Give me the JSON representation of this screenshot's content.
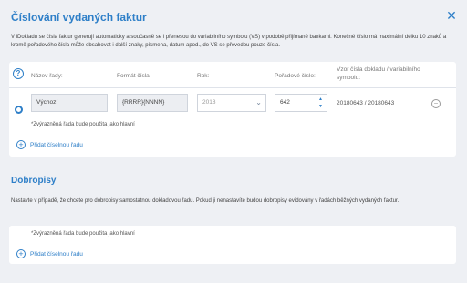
{
  "dialog": {
    "title": "Číslování vydaných faktur",
    "description": "V iDokladu se čísla faktur generují automaticky a současně se i přenesou do variabilního symbolu (VS) v podobě přijímané bankami. Konečné číslo má maximální délku 10 znaků a kromě pořadového čísla může obsahovat i další znaky, písmena, datum apod., do VS se převedou pouze čísla."
  },
  "table": {
    "headers": {
      "name": "Název řady:",
      "format": "Formát čísla:",
      "year": "Rok:",
      "order": "Pořadové číslo:",
      "sample_line1": "Vzor čísla dokladu / variabilního",
      "sample_line2": "symbolu:"
    },
    "row": {
      "name": "Výchozí",
      "format": "{RRRR}{NNNN}",
      "year": "2018",
      "order": "642",
      "sample": "20180643 / 20180643"
    },
    "note": "*Zvýrazněná řada bude použita jako hlavní",
    "add_label": "Přidat číselnou řadu"
  },
  "credit_notes": {
    "title": "Dobropisy",
    "description": "Nastavte v případě, že chcete pro dobropisy samostatnou dokladovou řadu. Pokud ji nenastavíte budou dobropisy evidovány v řadách běžných vydaných faktur.",
    "note": "*Zvýrazněná řada bude použita jako hlavní",
    "add_label": "Přidat číselnou řadu"
  },
  "icons": {
    "close": "close-icon",
    "help": "help-icon",
    "plus": "plus-circle-icon",
    "minus": "minus-circle-icon",
    "chevron": "chevron-down-icon"
  },
  "colors": {
    "accent": "#2e7fc8",
    "background": "#eef0f4",
    "card": "#ffffff"
  }
}
